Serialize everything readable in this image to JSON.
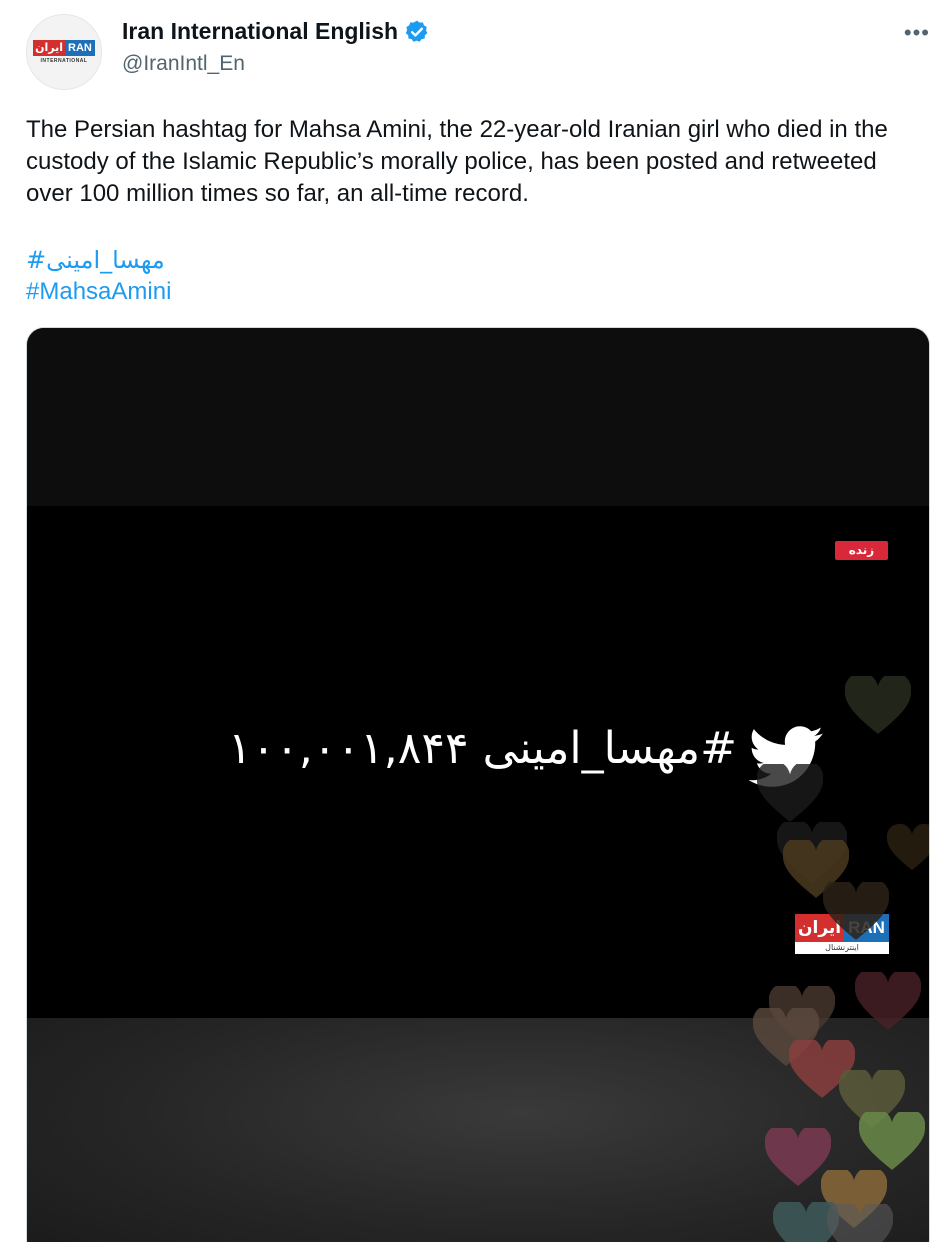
{
  "author": {
    "name": "Iran International English",
    "handle": "@IranIntl_En",
    "avatar_logo_fa": "ایران",
    "avatar_logo_en": "RAN",
    "avatar_logo_sub": "INTERNATIONAL"
  },
  "tweet": {
    "text": "The Persian hashtag for Mahsa Amini, the 22-year-old Iranian girl who died in the custody of the Islamic Republic’s morally police, has been posted and retweeted over 100 million times so far, an all-time record.",
    "hashtag_fa": "#مهسا_امینی",
    "hashtag_en": "#MahsaAmini"
  },
  "media": {
    "live_label": "زنده",
    "counter_text": "#مهسا_امینی ۱۰۰,۰۰۱,۸۴۴",
    "watermark_fa": "ایران",
    "watermark_en": "RAN",
    "watermark_sub": "اینترنشنال"
  },
  "icons": {
    "verified": "verified-badge-icon",
    "more": "more-icon",
    "bird": "twitter-bird-icon"
  },
  "colors": {
    "link": "#1d9bf0",
    "verified": "#1d9bf0",
    "live": "#d9283a"
  }
}
